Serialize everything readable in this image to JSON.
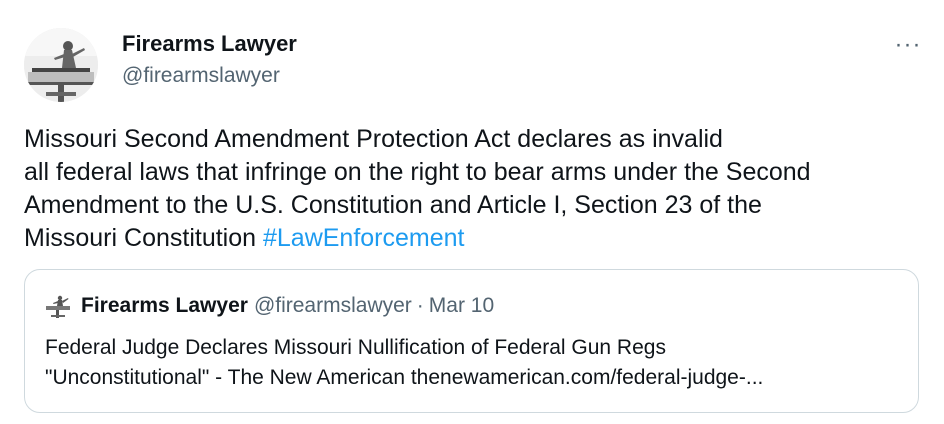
{
  "tweet": {
    "author_name": "Firearms Lawyer",
    "author_handle": "@firearmslawyer",
    "more_icon": "more-horizontal-icon",
    "more_label": "···",
    "text_lines": [
      "Missouri Second Amendment Protection Act declares as invalid",
      "all federal laws that infringe on the right to bear arms under the Second",
      "Amendment to the U.S. Constitution and Article I, Section 23 of the",
      "Missouri Constitution "
    ],
    "hashtag": "#LawEnforcement"
  },
  "quote": {
    "author_name": "Firearms Lawyer",
    "author_handle": "@firearmslawyer",
    "separator": "·",
    "date": "Mar 10",
    "text_lines": [
      "Federal Judge Declares Missouri Nullification of Federal Gun Regs",
      "\"Unconstitutional\" - The New American thenewamerican.com/federal-judge-..."
    ]
  },
  "colors": {
    "text": "#0f1419",
    "secondary": "#536471",
    "link": "#1d9bf0",
    "border": "#cfd9de"
  }
}
